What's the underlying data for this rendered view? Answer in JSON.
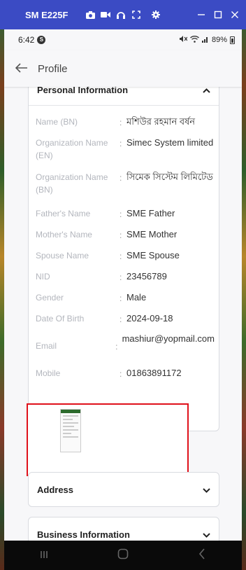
{
  "window": {
    "device_name": "SM E225F",
    "icons": [
      "camera-icon",
      "video-icon",
      "headphones-icon",
      "fullscreen-icon",
      "settings-icon"
    ],
    "controls": [
      "minimize-icon",
      "maximize-icon",
      "close-icon"
    ]
  },
  "statusbar": {
    "time": "6:42",
    "badge": "S",
    "battery": "89%"
  },
  "appbar": {
    "title": "Profile"
  },
  "personal_information": {
    "title": "Personal Information",
    "rows": [
      {
        "label": "Name (BN)",
        "value": "মশিউর রহমান বর্ষন"
      },
      {
        "label": "Organization Name (EN)",
        "value": "Simec System limited"
      },
      {
        "label": "Organization Name (BN)",
        "value": "সিমেক সিস্টেম লিমিটেড"
      },
      {
        "label": "Father's Name",
        "value": "SME Father"
      },
      {
        "label": "Mother's Name",
        "value": "SME Mother"
      },
      {
        "label": "Spouse Name",
        "value": "SME Spouse"
      },
      {
        "label": "NID",
        "value": "23456789"
      },
      {
        "label": "Gender",
        "value": "Male"
      },
      {
        "label": "Date Of Birth",
        "value": "2024-09-18"
      },
      {
        "label": "Email",
        "value": "mashiur@yopmail.com"
      },
      {
        "label": "Mobile",
        "value": "01863891172"
      }
    ]
  },
  "sections": {
    "address": "Address",
    "business": "Business Information"
  },
  "colors": {
    "titlebar": "#3b4bc4",
    "highlight_border": "#e0111b"
  }
}
